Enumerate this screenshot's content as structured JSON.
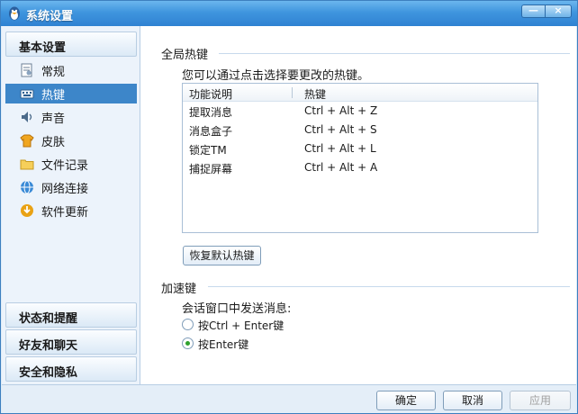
{
  "window": {
    "title": "系统设置",
    "minimize_glyph": "—",
    "close_glyph": "×"
  },
  "sidebar": {
    "headers": {
      "basic": "基本设置",
      "status": "状态和提醒",
      "friends": "好友和聊天",
      "security": "安全和隐私"
    },
    "items": [
      {
        "label": "常规",
        "icon": "settings-doc-icon"
      },
      {
        "label": "热键",
        "icon": "keyboard-icon"
      },
      {
        "label": "声音",
        "icon": "speaker-icon"
      },
      {
        "label": "皮肤",
        "icon": "shirt-icon"
      },
      {
        "label": "文件记录",
        "icon": "folder-icon"
      },
      {
        "label": "网络连接",
        "icon": "network-icon"
      },
      {
        "label": "软件更新",
        "icon": "update-icon"
      }
    ],
    "selected_index": 1
  },
  "hotkeys": {
    "section_title": "全局热键",
    "hint": "您可以通过点击选择要更改的热键。",
    "columns": [
      "功能说明",
      "热键"
    ],
    "rows": [
      {
        "name": "提取消息",
        "key": "Ctrl + Alt + Z"
      },
      {
        "name": "消息盒子",
        "key": "Ctrl + Alt + S"
      },
      {
        "name": "锁定TM",
        "key": "Ctrl + Alt + L"
      },
      {
        "name": "捕捉屏幕",
        "key": "Ctrl + Alt + A"
      }
    ],
    "restore_label": "恢复默认热键"
  },
  "accelerator": {
    "section_title": "加速键",
    "prompt": "会话窗口中发送消息:",
    "options": [
      {
        "label": "按Ctrl + Enter键",
        "selected": false
      },
      {
        "label": "按Enter键",
        "selected": true
      }
    ]
  },
  "footer": {
    "ok": "确定",
    "cancel": "取消",
    "apply": "应用"
  },
  "colors": {
    "title_bar": "#3f95de",
    "selection": "#3d86c9",
    "radio_selected": "#2ea12e"
  }
}
